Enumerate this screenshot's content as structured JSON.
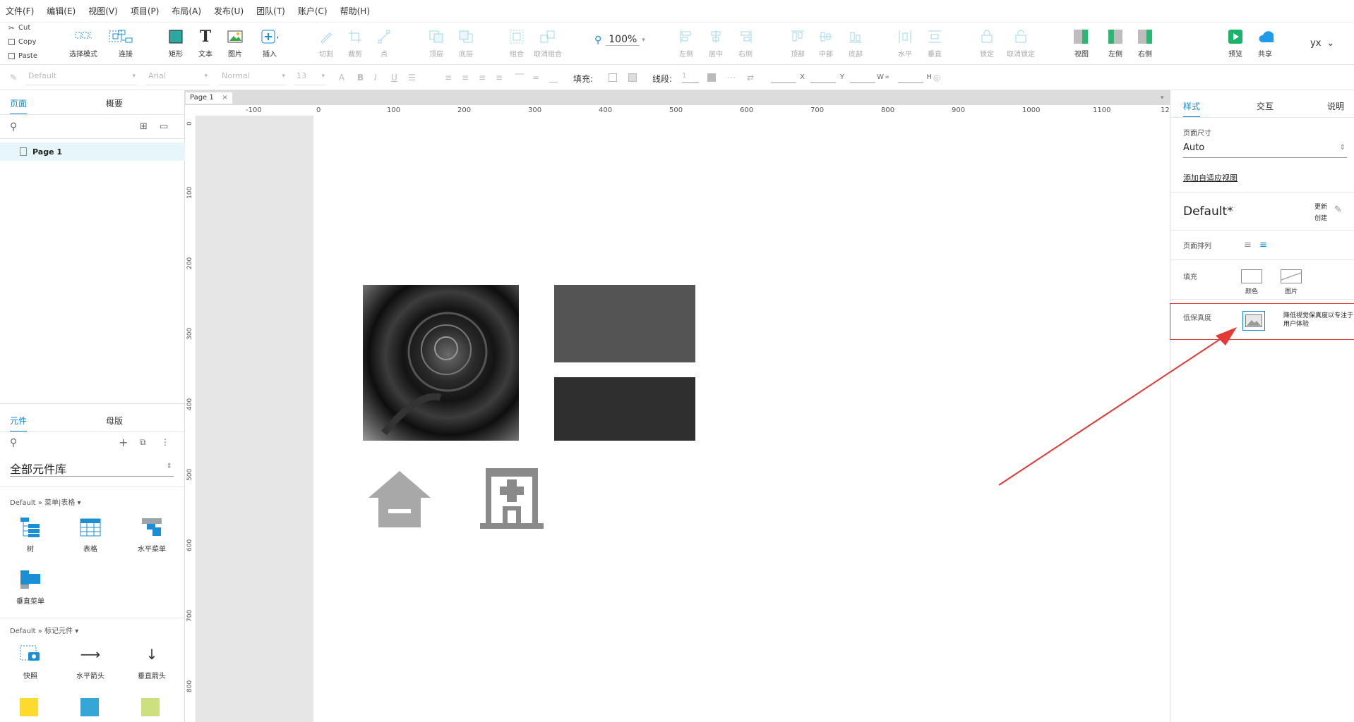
{
  "menu": [
    "文件(F)",
    "编辑(E)",
    "视图(V)",
    "项目(P)",
    "布局(A)",
    "发布(U)",
    "团队(T)",
    "账户(C)",
    "帮助(H)"
  ],
  "clipboard": {
    "cut": "Cut",
    "copy": "Copy",
    "paste": "Paste"
  },
  "toolbar": {
    "select_mode": "选择模式",
    "connect": "连接",
    "rect": "矩形",
    "text": "文本",
    "image": "图片",
    "insert": "插入",
    "cut": "切割",
    "crop": "裁剪",
    "point": "点",
    "top_layer": "顶层",
    "bottom_layer": "底层",
    "group": "组合",
    "ungroup": "取消组合",
    "zoom": "100%",
    "align_left": "左侧",
    "align_center": "居中",
    "align_right": "右侧",
    "align_top": "顶部",
    "align_middle": "中部",
    "align_bottom": "底部",
    "dist_h": "水平",
    "dist_v": "垂直",
    "lock": "锁定",
    "unlock": "取消锁定",
    "view": "视图",
    "left_panel": "左侧",
    "right_panel": "右侧",
    "preview": "预览",
    "share": "共享",
    "user": "yx"
  },
  "format": {
    "style": "Default",
    "font": "Arial",
    "weight": "Normal",
    "size": "13",
    "fill_label": "填充:",
    "line_label": "线段:",
    "line_value": "1",
    "x": "X",
    "y": "Y",
    "w": "W",
    "h": "H"
  },
  "left": {
    "tab_pages": "页面",
    "tab_outline": "概要",
    "page_item": "Page 1",
    "tab_widgets": "元件",
    "tab_masters": "母版",
    "library": "全部元件库",
    "section1": "Default » 菜单|表格 ▾",
    "section1_items": [
      "树",
      "表格",
      "水平菜单",
      "垂直菜单"
    ],
    "section2": "Default » 标记元件 ▾",
    "section2_items": [
      "快照",
      "水平箭头",
      "垂直箭头"
    ]
  },
  "canvas": {
    "page_tab": "Page 1",
    "ruler_h": [
      "-100",
      "0",
      "100",
      "200",
      "300",
      "400",
      "500",
      "600",
      "700",
      "800",
      "900",
      "1000",
      "1100",
      "12"
    ],
    "ruler_v": [
      "0",
      "100",
      "200",
      "300",
      "400",
      "500",
      "600",
      "700",
      "800"
    ]
  },
  "right": {
    "tab_style": "样式",
    "tab_interact": "交互",
    "tab_notes": "说明",
    "page_size_label": "页面尺寸",
    "page_size_value": "Auto",
    "adaptive_link": "添加自适应视图",
    "style_name": "Default*",
    "update_label": "更新",
    "create_label": "创建",
    "page_align_label": "页面排列",
    "fill_label": "填充",
    "fill_color": "颜色",
    "fill_image": "图片",
    "low_fidelity_label": "低保真度",
    "low_fidelity_desc": "降低视觉保真度以专注于用户体验"
  },
  "colors": {
    "accent": "#0a89d0",
    "highlight": "#e53935",
    "preview_green": "#19b36b",
    "share_blue": "#1e9be9"
  }
}
